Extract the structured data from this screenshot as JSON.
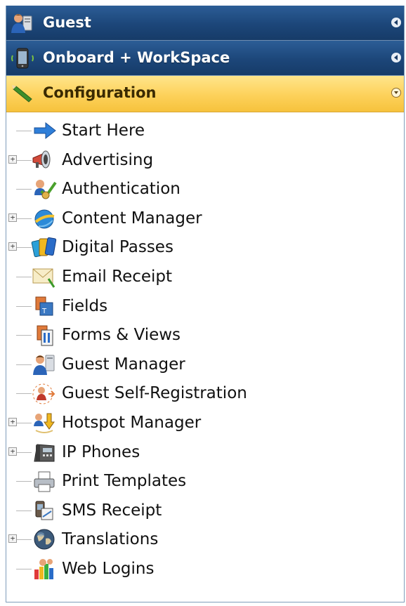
{
  "headers": [
    {
      "label": "Guest",
      "icon": "guest-icon"
    },
    {
      "label": "Onboard + WorkSpace",
      "icon": "phone-icon"
    },
    {
      "label": "Configuration",
      "icon": "pen-icon"
    }
  ],
  "tree": [
    {
      "label": "Start Here",
      "expandable": false,
      "icon": "arrow-right-icon"
    },
    {
      "label": "Advertising",
      "expandable": true,
      "icon": "megaphone-icon"
    },
    {
      "label": "Authentication",
      "expandable": false,
      "icon": "authentication-icon"
    },
    {
      "label": "Content Manager",
      "expandable": true,
      "icon": "browser-icon"
    },
    {
      "label": "Digital Passes",
      "expandable": true,
      "icon": "passes-icon"
    },
    {
      "label": "Email Receipt",
      "expandable": false,
      "icon": "envelope-icon"
    },
    {
      "label": "Fields",
      "expandable": false,
      "icon": "fields-icon"
    },
    {
      "label": "Forms & Views",
      "expandable": false,
      "icon": "forms-icon"
    },
    {
      "label": "Guest Manager",
      "expandable": false,
      "icon": "guest-manager-icon"
    },
    {
      "label": "Guest Self-Registration",
      "expandable": false,
      "icon": "self-registration-icon"
    },
    {
      "label": "Hotspot Manager",
      "expandable": true,
      "icon": "hotspot-icon"
    },
    {
      "label": "IP Phones",
      "expandable": true,
      "icon": "ip-phone-icon"
    },
    {
      "label": "Print Templates",
      "expandable": false,
      "icon": "printer-icon"
    },
    {
      "label": "SMS Receipt",
      "expandable": false,
      "icon": "sms-icon"
    },
    {
      "label": "Translations",
      "expandable": true,
      "icon": "globe-icon"
    },
    {
      "label": "Web Logins",
      "expandable": false,
      "icon": "web-logins-icon"
    }
  ],
  "colors": {
    "header_blue": "#1c4679",
    "header_gold": "#fdd15a"
  }
}
